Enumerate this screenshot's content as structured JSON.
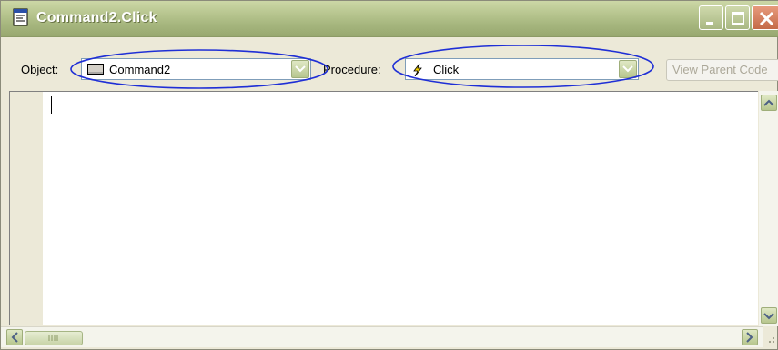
{
  "window": {
    "title": "Command2.Click",
    "title_icon": "code-window-icon",
    "buttons": [
      "minimize-icon",
      "maximize-icon",
      "close-icon"
    ]
  },
  "toolbar": {
    "object_label_prefix": "O",
    "object_label_mnemonic": "b",
    "object_label_suffix": "ject:",
    "object_value": "Command2",
    "object_icon": "command-button-icon",
    "procedure_label_mnemonic": "P",
    "procedure_label_suffix": "rocedure:",
    "procedure_value": "Click",
    "procedure_icon": "lightning-event-icon",
    "view_parent_label": "View Parent Code",
    "highlight_color": "#1f2fd6"
  },
  "editor": {
    "content": ""
  },
  "colors": {
    "titlebar": "#a4b47c",
    "window_face": "#ece9d8",
    "combo_border": "#7f9db9"
  }
}
